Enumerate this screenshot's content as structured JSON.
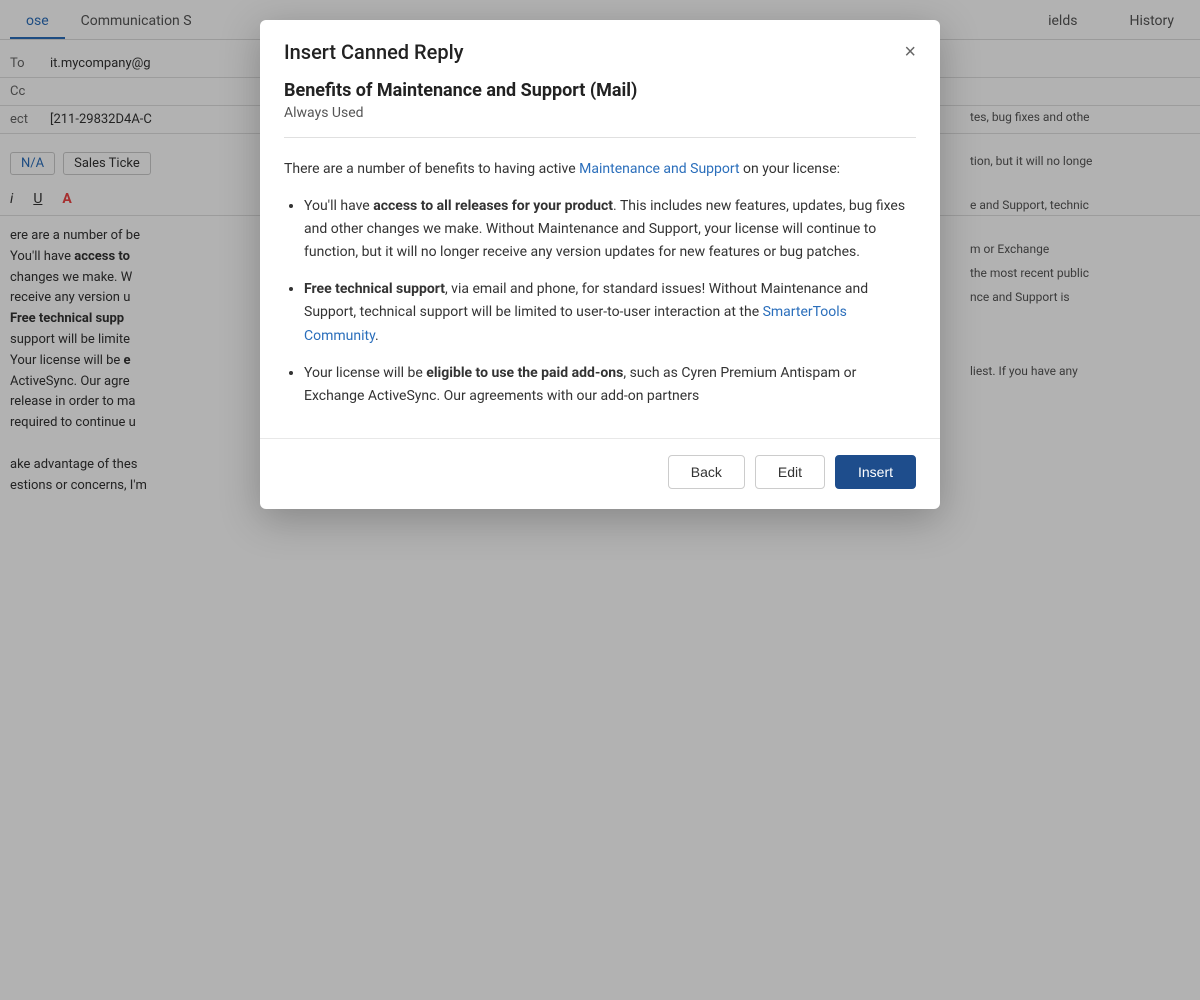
{
  "tabs": {
    "left": [
      {
        "label": "ose",
        "active": true
      },
      {
        "label": "Communication S",
        "active": false
      }
    ],
    "right": [
      {
        "label": "ields",
        "active": false
      },
      {
        "label": "History",
        "active": false
      }
    ]
  },
  "form": {
    "to_label": "To",
    "to_value": "it.mycompany@g",
    "cc_label": "Cc",
    "cc_value": "",
    "subject_label": "ect",
    "subject_value": "[211-29832D4A-C"
  },
  "tags": {
    "product": "N/A",
    "type": "Sales Ticke"
  },
  "toolbar": {
    "italic": "i",
    "underline": "U",
    "font_color": "A"
  },
  "body_text": "ere are a number of be\nYou'll have access to\nchanges we make. W\nreceive any version u\nFree technical supp\nsupport will be limite\nYour license will be e\nActiveSynce. Our agre\nrelease in order to ma\nrequired to continue u\n\nake advantage of thes\nestions or concerns, I'm",
  "right_panel": [
    "tes, bug fixes and othe",
    "tion, but it will no longe",
    "e and Support, technic",
    "m or Exchange",
    "the most recent public",
    "nce and Support is",
    "liest. If you have any"
  ],
  "modal": {
    "title": "Insert Canned Reply",
    "close_label": "×",
    "reply_title": "Benefits of Maintenance and Support (Mail)",
    "reply_subtitle": "Always Used",
    "intro_text": "There are a number of benefits to having active",
    "link_text": "Maintenance and Support",
    "intro_suffix": " on your license:",
    "bullet_points": [
      {
        "bold_prefix": "access to all releases for your product",
        "prefix": "You'll have ",
        "text": ". This includes new features, updates, bug fixes and other changes we make. Without Maintenance and Support, your license will continue to function, but it will no longer receive any version updates for new features or bug patches."
      },
      {
        "bold_prefix": "Free technical support",
        "prefix": "",
        "text": ", via email and phone, for standard issues! Without Maintenance and Support, technical support will be limited to user-to-user interaction at the",
        "link_text": "SmarterTools Community",
        "text_after": "."
      },
      {
        "bold_prefix": "eligible to use the paid add-ons",
        "prefix": "Your license will be ",
        "text": ", such as Cyren Premium Antispam or Exchange ActiveSync. Our agreements with our add-on partners"
      }
    ],
    "buttons": {
      "back": "Back",
      "edit": "Edit",
      "insert": "Insert"
    }
  }
}
